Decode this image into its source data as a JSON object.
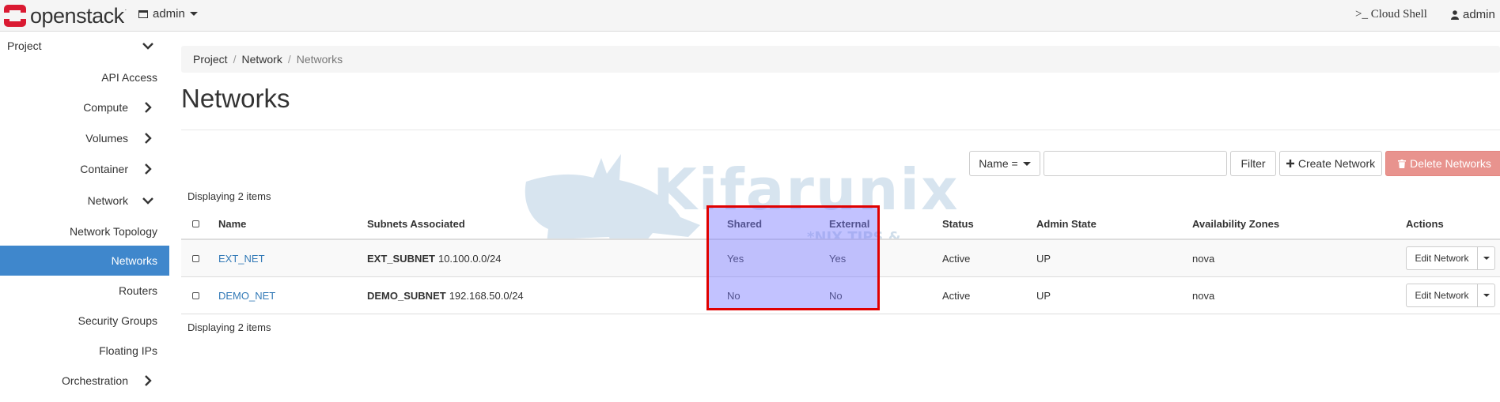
{
  "topnav": {
    "brand": "openstack",
    "brand_mark": ".",
    "project": "admin",
    "cloud_shell": ">_ Cloud Shell",
    "user": "admin"
  },
  "sidebar": {
    "items": [
      {
        "label": "Project"
      },
      {
        "label": "API Access"
      },
      {
        "label": "Compute"
      },
      {
        "label": "Volumes"
      },
      {
        "label": "Container"
      },
      {
        "label": "Network"
      },
      {
        "label": "Network Topology"
      },
      {
        "label": "Networks"
      },
      {
        "label": "Routers"
      },
      {
        "label": "Security Groups"
      },
      {
        "label": "Floating IPs"
      },
      {
        "label": "Orchestration"
      }
    ]
  },
  "breadcrumb": [
    "Project",
    "Network",
    "Networks"
  ],
  "page": {
    "title": "Networks"
  },
  "toolbar": {
    "filter_field": "Name =",
    "filter_value": "",
    "filter_button": "Filter",
    "create_button": "Create Network",
    "delete_button": "Delete Networks"
  },
  "table": {
    "count_label": "Displaying 2 items",
    "headers": [
      "Name",
      "Subnets Associated",
      "Shared",
      "External",
      "Status",
      "Admin State",
      "Availability Zones",
      "Actions"
    ],
    "rows": [
      {
        "name": "EXT_NET",
        "subnet_name": "EXT_SUBNET",
        "subnet_cidr": "10.100.0.0/24",
        "shared": "Yes",
        "external": "Yes",
        "status": "Active",
        "admin_state": "UP",
        "az": "nova",
        "action": "Edit Network"
      },
      {
        "name": "DEMO_NET",
        "subnet_name": "DEMO_SUBNET",
        "subnet_cidr": "192.168.50.0/24",
        "shared": "No",
        "external": "No",
        "status": "Active",
        "admin_state": "UP",
        "az": "nova",
        "action": "Edit Network"
      }
    ]
  },
  "watermark": {
    "text": "Kifarunix",
    "tagline": "*NIX TIPS & TUTORIALS"
  },
  "colors": {
    "active_nav": "#3f87cc",
    "link": "#337ab7",
    "danger": "#e8938e",
    "highlight_border": "#e00000"
  }
}
